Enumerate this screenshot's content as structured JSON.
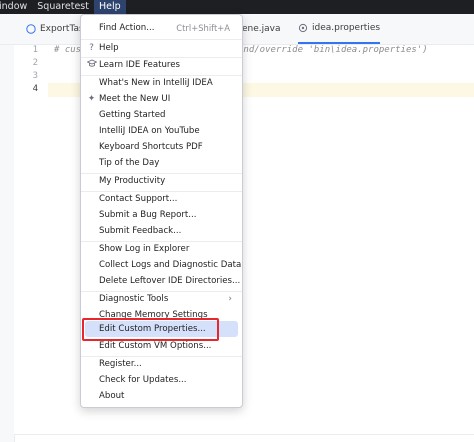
{
  "menubar": {
    "items": [
      "indow",
      "Squaretest",
      "Help"
    ]
  },
  "tabs": [
    {
      "label": "ExportTas"
    },
    {
      "label": "ene.java"
    },
    {
      "label": "idea.properties"
    }
  ],
  "editor": {
    "line_numbers": [
      "1",
      "2",
      "3",
      "4"
    ],
    "line1_left": "# cus",
    "line1_right": "and/override 'bin\\idea.properties')"
  },
  "help_menu": {
    "find_action": "Find Action...",
    "find_action_shortcut": "Ctrl+Shift+A",
    "help": "Help",
    "learn": "Learn IDE Features",
    "whats_new": "What's New in IntelliJ IDEA",
    "meet_new_ui": "Meet the New UI",
    "getting_started": "Getting Started",
    "youtube": "IntelliJ IDEA on YouTube",
    "shortcuts_pdf": "Keyboard Shortcuts PDF",
    "tip": "Tip of the Day",
    "productivity": "My Productivity",
    "contact_support": "Contact Support...",
    "bug_report": "Submit a Bug Report...",
    "feedback": "Submit Feedback...",
    "show_log": "Show Log in Explorer",
    "collect_logs": "Collect Logs and Diagnostic Data",
    "delete_leftover": "Delete Leftover IDE Directories...",
    "diagnostic_tools": "Diagnostic Tools",
    "change_memory": "Change Memory Settings",
    "edit_custom_props": "Edit Custom Properties...",
    "edit_custom_vm": "Edit Custom VM Options...",
    "register": "Register...",
    "check_updates": "Check for Updates...",
    "about": "About"
  },
  "colors": {
    "highlight": "#d5e1fb",
    "annotation_box": "#e8262c",
    "menubar_bg": "#1e1f22"
  }
}
